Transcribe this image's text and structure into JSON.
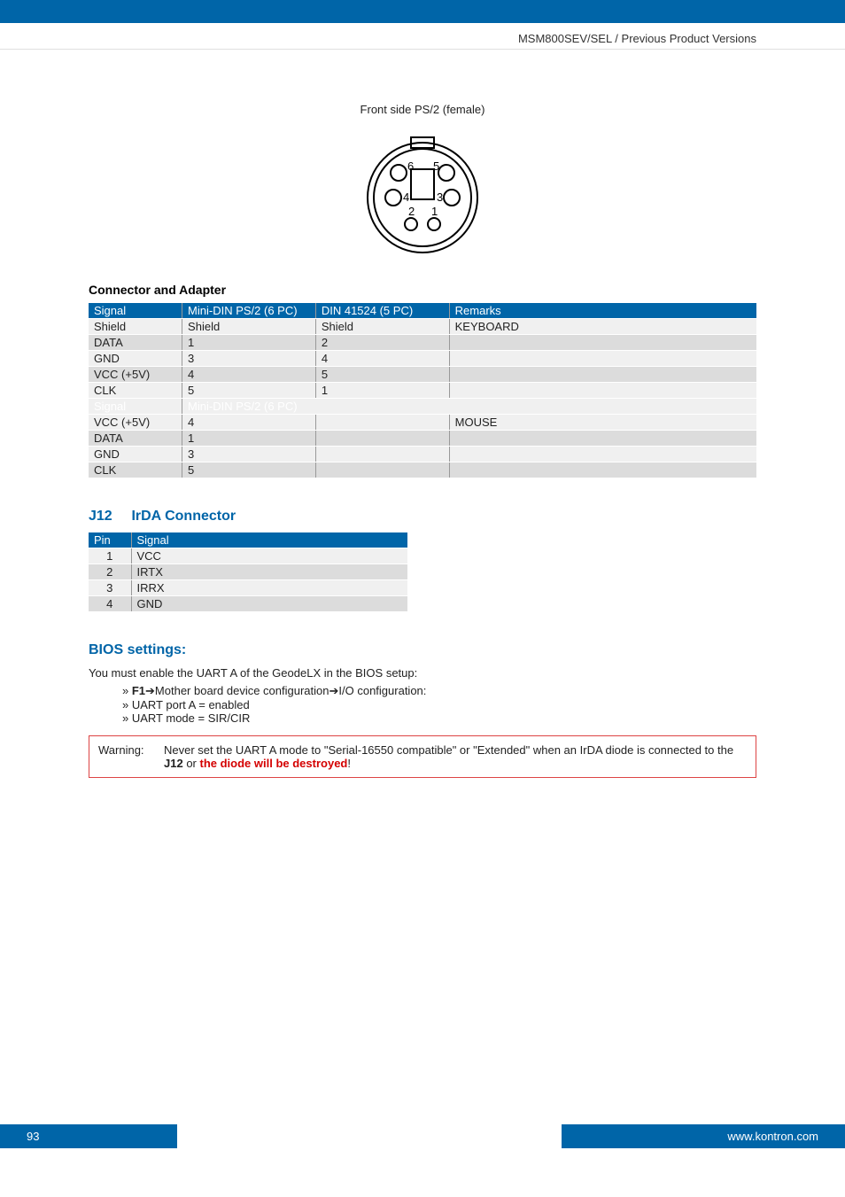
{
  "breadcrumb": "MSM800SEV/SEL / Previous Product Versions",
  "figure_caption": "Front side PS/2 (female)",
  "connector_section_title": "Connector and Adapter",
  "connector_table": {
    "headers": [
      "Signal",
      "Mini-DIN PS/2 (6 PC)",
      "DIN 41524 (5 PC)",
      "Remarks"
    ],
    "rows_keyboard": [
      [
        "Shield",
        "Shield",
        "Shield",
        "KEYBOARD"
      ],
      [
        "DATA",
        "1",
        "2",
        ""
      ],
      [
        "GND",
        "3",
        "4",
        ""
      ],
      [
        "VCC (+5V)",
        "4",
        "5",
        ""
      ],
      [
        "CLK",
        "5",
        "1",
        ""
      ]
    ],
    "subheader": [
      "Signal",
      "Mini-DIN PS/2 (6 PC)"
    ],
    "rows_mouse": [
      [
        "VCC (+5V)",
        "4",
        "",
        "MOUSE"
      ],
      [
        "DATA",
        "1",
        "",
        ""
      ],
      [
        "GND",
        "3",
        "",
        ""
      ],
      [
        "CLK",
        "5",
        "",
        ""
      ]
    ]
  },
  "irda": {
    "label": "J12",
    "title": "IrDA Connector",
    "headers": [
      "Pin",
      "Signal"
    ],
    "rows": [
      [
        "1",
        "VCC"
      ],
      [
        "2",
        "IRTX"
      ],
      [
        "3",
        "IRRX"
      ],
      [
        "4",
        "GND"
      ]
    ]
  },
  "bios": {
    "title": "BIOS settings:",
    "intro": "You must enable the UART A of the GeodeLX in the BIOS setup:",
    "line1_prefix": "F1",
    "line1_mid": "Mother board device configuration",
    "line1_suffix": "I/O configuration:",
    "line2": "UART port A = enabled",
    "line3": "UART mode = SIR/CIR"
  },
  "warning": {
    "label": "Warning:",
    "text_a": "Never set the UART A mode to \"Serial-16550 compatible\" or \"Extended\" when an IrDA diode is connected to the ",
    "bold": "J12",
    "text_b": " or ",
    "red": "the diode will be destroyed",
    "end": "!"
  },
  "footer": {
    "page": "93",
    "url": "www.kontron.com"
  }
}
